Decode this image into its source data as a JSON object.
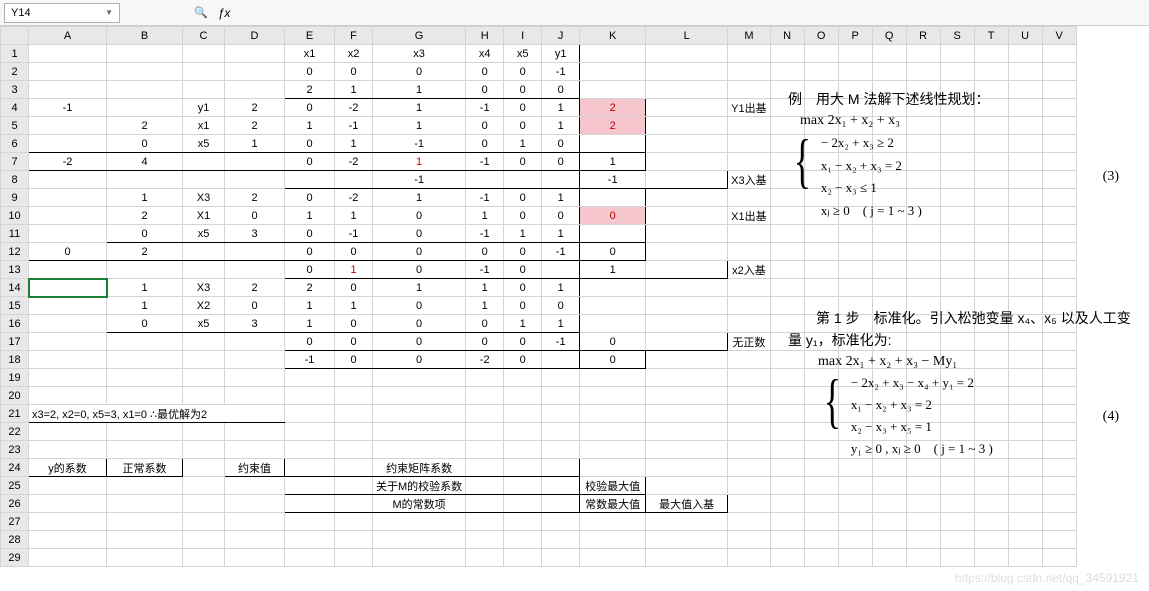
{
  "cellRef": "Y14",
  "fx": "ƒx",
  "colHeaders": [
    "A",
    "B",
    "C",
    "D",
    "E",
    "F",
    "G",
    "H",
    "I",
    "J",
    "K",
    "L",
    "M",
    "N",
    "O",
    "P",
    "Q",
    "R",
    "S",
    "T",
    "U",
    "V"
  ],
  "rows": [
    [
      "",
      "",
      "",
      "",
      "x1",
      "x2",
      "x3",
      "x4",
      "x5",
      "y1",
      "",
      "",
      "",
      "",
      "",
      "",
      "",
      "",
      "",
      "",
      "",
      "",
      ""
    ],
    [
      "",
      "",
      "",
      "",
      "0",
      "0",
      "0",
      "0",
      "0",
      "-1",
      "",
      "",
      "",
      "",
      "",
      "",
      "",
      "",
      "",
      "",
      "",
      "",
      ""
    ],
    [
      "",
      "",
      "",
      "",
      "2",
      "1",
      "1",
      "0",
      "0",
      "0",
      "",
      "",
      "",
      "",
      "",
      "",
      "",
      "",
      "",
      "",
      "",
      "",
      ""
    ],
    [
      "-1",
      "",
      "y1",
      "2",
      "0",
      "-2",
      "1",
      "-1",
      "0",
      "1",
      "2",
      "",
      "Y1出基",
      "",
      "",
      "",
      "",
      "",
      "",
      "",
      "",
      "",
      ""
    ],
    [
      "",
      "2",
      "x1",
      "2",
      "1",
      "-1",
      "1",
      "0",
      "0",
      "1",
      "2",
      "",
      "",
      "",
      "",
      "",
      "",
      "",
      "",
      "",
      "",
      "",
      ""
    ],
    [
      "",
      "0",
      "x5",
      "1",
      "0",
      "1",
      "-1",
      "0",
      "1",
      "0",
      "",
      "",
      "",
      "",
      "",
      "",
      "",
      "",
      "",
      "",
      "",
      "",
      ""
    ],
    [
      "-2",
      "4",
      "",
      "",
      "0",
      "-2",
      "1",
      "-1",
      "0",
      "0",
      "1",
      "",
      "",
      "",
      "",
      "",
      "",
      "",
      "",
      "",
      "",
      "",
      ""
    ],
    [
      "",
      "",
      "",
      "",
      "",
      "",
      "-1",
      "",
      "",
      "",
      "-1",
      "",
      "X3入基",
      "",
      "",
      "",
      "",
      "",
      "",
      "",
      "",
      "",
      ""
    ],
    [
      "",
      "1",
      "X3",
      "2",
      "0",
      "-2",
      "1",
      "-1",
      "0",
      "1",
      "",
      "",
      "",
      "",
      "",
      "",
      "",
      "",
      "",
      "",
      "",
      "",
      ""
    ],
    [
      "",
      "2",
      "X1",
      "0",
      "1",
      "1",
      "0",
      "1",
      "0",
      "0",
      "0",
      "",
      "X1出基",
      "",
      "",
      "",
      "",
      "",
      "",
      "",
      "",
      "",
      ""
    ],
    [
      "",
      "0",
      "x5",
      "3",
      "0",
      "-1",
      "0",
      "-1",
      "1",
      "1",
      "",
      "",
      "",
      "",
      "",
      "",
      "",
      "",
      "",
      "",
      "",
      "",
      ""
    ],
    [
      "0",
      "2",
      "",
      "",
      "0",
      "0",
      "0",
      "0",
      "0",
      "-1",
      "0",
      "",
      "",
      "",
      "",
      "",
      "",
      "",
      "",
      "",
      "",
      "",
      ""
    ],
    [
      "",
      "",
      "",
      "",
      "0",
      "1",
      "0",
      "-1",
      "0",
      "",
      "1",
      "",
      "x2入基",
      "",
      "",
      "",
      "",
      "",
      "",
      "",
      "",
      "",
      ""
    ],
    [
      "",
      "1",
      "X3",
      "2",
      "2",
      "0",
      "1",
      "1",
      "0",
      "1",
      "",
      "",
      "",
      "",
      "",
      "",
      "",
      "",
      "",
      "",
      "",
      "",
      ""
    ],
    [
      "",
      "1",
      "X2",
      "0",
      "1",
      "1",
      "0",
      "1",
      "0",
      "0",
      "",
      "",
      "",
      "",
      "",
      "",
      "",
      "",
      "",
      "",
      "",
      "",
      ""
    ],
    [
      "",
      "0",
      "x5",
      "3",
      "1",
      "0",
      "0",
      "0",
      "1",
      "1",
      "",
      "",
      "",
      "",
      "",
      "",
      "",
      "",
      "",
      "",
      "",
      "",
      ""
    ],
    [
      "",
      "",
      "",
      "",
      "0",
      "0",
      "0",
      "0",
      "0",
      "-1",
      "0",
      "",
      "无正数",
      "",
      "",
      "",
      "",
      "",
      "",
      "",
      "",
      "",
      ""
    ],
    [
      "",
      "",
      "",
      "",
      "-1",
      "0",
      "0",
      "-2",
      "0",
      "",
      "0",
      "",
      "",
      "",
      "",
      "",
      "",
      "",
      "",
      "",
      "",
      "",
      ""
    ],
    [
      "",
      "",
      "",
      "",
      "",
      "",
      "",
      "",
      "",
      "",
      "",
      "",
      "",
      "",
      "",
      "",
      "",
      "",
      "",
      "",
      "",
      "",
      ""
    ],
    [
      "",
      "",
      "",
      "",
      "",
      "",
      "",
      "",
      "",
      "",
      "",
      "",
      "",
      "",
      "",
      "",
      "",
      "",
      "",
      "",
      "",
      "",
      ""
    ],
    [
      "x3=2, x2=0, x5=3, x1=0   ∴最优解为2",
      "",
      "",
      "",
      "",
      "",
      "",
      "",
      "",
      "",
      "",
      "",
      "",
      "",
      "",
      "",
      "",
      "",
      "",
      "",
      "",
      "",
      ""
    ],
    [
      "",
      "",
      "",
      "",
      "",
      "",
      "",
      "",
      "",
      "",
      "",
      "",
      "",
      "",
      "",
      "",
      "",
      "",
      "",
      "",
      "",
      "",
      ""
    ],
    [
      "",
      "",
      "",
      "",
      "",
      "",
      "",
      "",
      "",
      "",
      "",
      "",
      "",
      "",
      "",
      "",
      "",
      "",
      "",
      "",
      "",
      "",
      ""
    ],
    [
      "y的系数",
      "正常系数",
      "",
      "约束值",
      "",
      "",
      "约束矩阵系数",
      "",
      "",
      "",
      "",
      "",
      "",
      "",
      "",
      "",
      "",
      "",
      "",
      "",
      "",
      "",
      ""
    ],
    [
      "",
      "",
      "",
      "",
      "",
      "",
      "关于M的校验系数",
      "",
      "",
      "",
      "校验最大值",
      "",
      "",
      "",
      "",
      "",
      "",
      "",
      "",
      "",
      "",
      "",
      ""
    ],
    [
      "",
      "",
      "",
      "",
      "",
      "",
      "M的常数项",
      "",
      "",
      "",
      "常数最大值",
      "最大值入基",
      "",
      "",
      "",
      "",
      "",
      "",
      "",
      "",
      "",
      "",
      ""
    ],
    [
      "",
      "",
      "",
      "",
      "",
      "",
      "",
      "",
      "",
      "",
      "",
      "",
      "",
      "",
      "",
      "",
      "",
      "",
      "",
      "",
      "",
      "",
      ""
    ],
    [
      "",
      "",
      "",
      "",
      "",
      "",
      "",
      "",
      "",
      "",
      "",
      "",
      "",
      "",
      "",
      "",
      "",
      "",
      "",
      "",
      "",
      "",
      ""
    ],
    [
      "",
      "",
      "",
      "",
      "",
      "",
      "",
      "",
      "",
      "",
      "",
      "",
      "",
      "",
      "",
      "",
      "",
      "",
      "",
      "",
      "",
      "",
      ""
    ]
  ],
  "highlights": {
    "K4": "hl",
    "K5": "hl",
    "G7": "redtxt",
    "K10": "hl",
    "F13": "redtxt"
  },
  "math1": {
    "title": "例　用大 M 法解下述线性规划：",
    "objective": "max 2x₁ + x₂ + x₃",
    "constraints": [
      "− 2x₂ + x₃ ≥ 2",
      "x₁ − x₂ + x₃ = 2",
      "x₂ − x₃ ≤ 1",
      "xⱼ ≥ 0　( j = 1 ~ 3 )"
    ],
    "num": "(3)"
  },
  "math2": {
    "p1": "第 1 步　标准化。引入松弛变量 x₄、x₅ 以及人工变量 y₁，标准化为:",
    "objective": "max 2x₁ + x₂ + x₃ − My₁",
    "constraints": [
      "− 2x₂ + x₃ − x₄ + y₁ = 2",
      "x₁ − x₂ + x₃ = 2",
      "x₂ − x₃ + x₅ = 1",
      "y₁ ≥ 0 , xⱼ ≥ 0　( j = 1 ~ 3 )"
    ],
    "num": "(4)"
  },
  "watermark": "https://blog.csdn.net/qq_34591921",
  "chart_data": {
    "type": "table",
    "title": "Big-M Simplex Method Iterations",
    "variables": [
      "x1",
      "x2",
      "x3",
      "x4",
      "x5",
      "y1"
    ],
    "objective_normal": [
      2,
      1,
      1,
      0,
      0,
      0
    ],
    "objective_M": [
      0,
      0,
      0,
      0,
      0,
      -1
    ],
    "iterations": [
      {
        "basis": [
          {
            "coef_M": -1,
            "coef_c": null,
            "var": "y1",
            "b": 2,
            "row": [
              0,
              -2,
              1,
              -1,
              0,
              1
            ],
            "ratio": 2,
            "leave": true
          },
          {
            "coef_M": null,
            "coef_c": 2,
            "var": "x1",
            "b": 2,
            "row": [
              1,
              -1,
              1,
              0,
              0,
              1
            ],
            "ratio": 2
          },
          {
            "coef_M": null,
            "coef_c": 0,
            "var": "x5",
            "b": 1,
            "row": [
              0,
              1,
              -1,
              0,
              1,
              0
            ]
          }
        ],
        "zj_M_row": {
          "a": -2,
          "b": 4,
          "vals": [
            0,
            -2,
            1,
            -1,
            0,
            0
          ],
          "max": 1
        },
        "zj_const_row": {
          "vals": [
            null,
            null,
            -1,
            null,
            null,
            null
          ],
          "max": -1
        },
        "enter": "x3",
        "leave": "y1"
      },
      {
        "basis": [
          {
            "coef_c": 1,
            "var": "X3",
            "b": 2,
            "row": [
              0,
              -2,
              1,
              -1,
              0,
              1
            ]
          },
          {
            "coef_c": 2,
            "var": "X1",
            "b": 0,
            "row": [
              1,
              1,
              0,
              1,
              0,
              0
            ],
            "ratio": 0,
            "leave": true
          },
          {
            "coef_c": 0,
            "var": "x5",
            "b": 3,
            "row": [
              0,
              -1,
              0,
              -1,
              1,
              1
            ]
          }
        ],
        "zj_M_row": {
          "a": 0,
          "b": 2,
          "vals": [
            0,
            0,
            0,
            0,
            0,
            -1
          ],
          "max": 0
        },
        "zj_const_row": {
          "vals": [
            0,
            1,
            0,
            -1,
            0,
            null
          ],
          "max": 1
        },
        "enter": "x2",
        "leave": "x1"
      },
      {
        "basis": [
          {
            "coef_c": 1,
            "var": "X3",
            "b": 2,
            "row": [
              2,
              0,
              1,
              1,
              0,
              1
            ]
          },
          {
            "coef_c": 1,
            "var": "X2",
            "b": 0,
            "row": [
              1,
              1,
              0,
              1,
              0,
              0
            ]
          },
          {
            "coef_c": 0,
            "var": "x5",
            "b": 3,
            "row": [
              1,
              0,
              0,
              0,
              1,
              1
            ]
          }
        ],
        "zj_M_row": {
          "vals": [
            0,
            0,
            0,
            0,
            0,
            -1
          ],
          "max": 0,
          "note": "无正数"
        },
        "zj_const_row": {
          "vals": [
            -1,
            0,
            0,
            -2,
            0,
            null
          ],
          "max": 0
        }
      }
    ],
    "optimal": {
      "x3": 2,
      "x2": 0,
      "x5": 3,
      "x1": 0,
      "objective": 2
    },
    "legend": [
      "y的系数",
      "正常系数",
      "约束值",
      "约束矩阵系数",
      "关于M的校验系数",
      "校验最大值",
      "M的常数项",
      "常数最大值",
      "最大值入基"
    ]
  }
}
